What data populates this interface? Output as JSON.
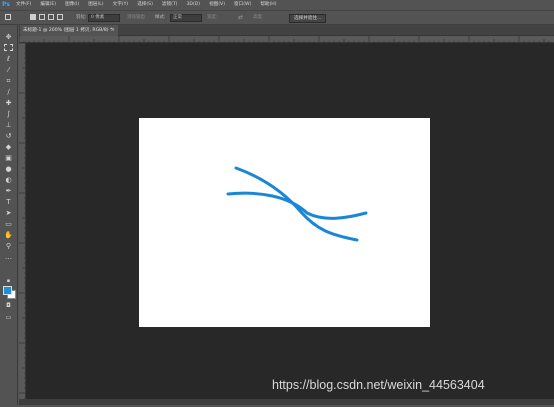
{
  "app": {
    "logo": "Ps"
  },
  "menubar": {
    "items": [
      "文件(F)",
      "编辑(E)",
      "图像(I)",
      "图层(L)",
      "文字(Y)",
      "选择(S)",
      "滤镜(T)",
      "3D(D)",
      "视图(V)",
      "窗口(W)",
      "帮助(H)"
    ]
  },
  "options": {
    "feather_label": "羽化:",
    "feather_value": "0 像素",
    "antialias_label": "消除锯齿",
    "style_label": "样式:",
    "style_value": "正常",
    "width_label": "宽度:",
    "height_label": "高度:",
    "select_subject": "选择并遮住..."
  },
  "document_tab": {
    "title": "未标题-1 @ 200% (图层 1 拷贝, RGB/8) *",
    "close": "×"
  },
  "toolbar": {
    "tools": [
      "move-icon",
      "marquee-icon",
      "lasso-icon",
      "quick-select-icon",
      "crop-icon",
      "eyedropper-icon",
      "healing-icon",
      "brush-icon",
      "stamp-icon",
      "history-brush-icon",
      "eraser-icon",
      "gradient-icon",
      "blur-icon",
      "dodge-icon",
      "pen-icon",
      "type-icon",
      "path-select-icon",
      "rectangle-icon",
      "hand-icon",
      "zoom-icon",
      "more-icon"
    ],
    "foreground_color": "#1e90d8",
    "background_color": "#ffffff"
  },
  "canvas": {
    "background": "#ffffff",
    "stroke_color": "#1a87d6"
  },
  "watermark": "https://blog.csdn.net/weixin_44563404"
}
